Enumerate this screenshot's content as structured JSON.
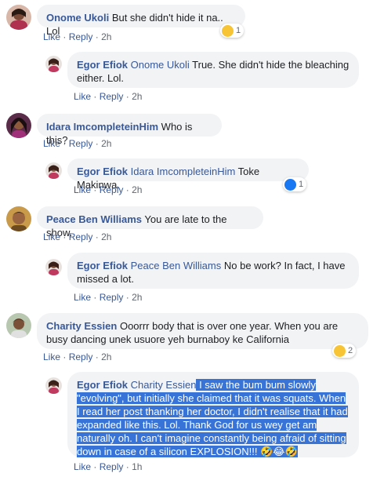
{
  "actions": {
    "like": "Like",
    "reply": "Reply",
    "sep": "·"
  },
  "comments": [
    {
      "author": "Onome Ukoli",
      "text": "But she didn't hide it na.. Lol",
      "time": "2h",
      "reaction": "haha",
      "reaction_count": "1"
    },
    {
      "author": "Egor Efiok",
      "mention": "Onome Ukoli",
      "text": " True. She didn't hide the bleaching either. Lol.",
      "time": "2h"
    },
    {
      "author": "Idara ImcompleteinHim",
      "text": "Who is this?",
      "time": "2h"
    },
    {
      "author": "Egor Efiok",
      "mention": "Idara ImcompleteinHim",
      "text": " Toke Makinwa.",
      "time": "2h",
      "reaction": "like",
      "reaction_count": "1"
    },
    {
      "author": "Peace Ben Williams",
      "text": "You are late to the show.",
      "time": "2h"
    },
    {
      "author": "Egor Efiok",
      "mention": "Peace Ben Williams",
      "text": " No be work? In fact, I have missed a lot.",
      "time": "2h"
    },
    {
      "author": "Charity Essien",
      "text": "Ooorrr body that is over one year. When you are busy dancing unek usuore yeh burnaboy ke California",
      "time": "2h",
      "reaction": "haha",
      "reaction_count": "2"
    },
    {
      "author": "Egor Efiok",
      "mention": "Charity Essien",
      "text": " I saw the bum bum slowly \"evolving\", but initially she claimed that it was squats. When I read her post thanking her doctor, I didn't realise that it had expanded like this. Lol. Thank God for us wey get am naturally oh. I can't imagine constantly being afraid of sitting down in case of a silicon EXPLOSION!!! 🤣😂🤣",
      "time": "1h"
    }
  ],
  "colors": {
    "link": "#385898",
    "bubble": "#f2f3f5",
    "highlight": "#3874d8",
    "meta": "#606770"
  }
}
